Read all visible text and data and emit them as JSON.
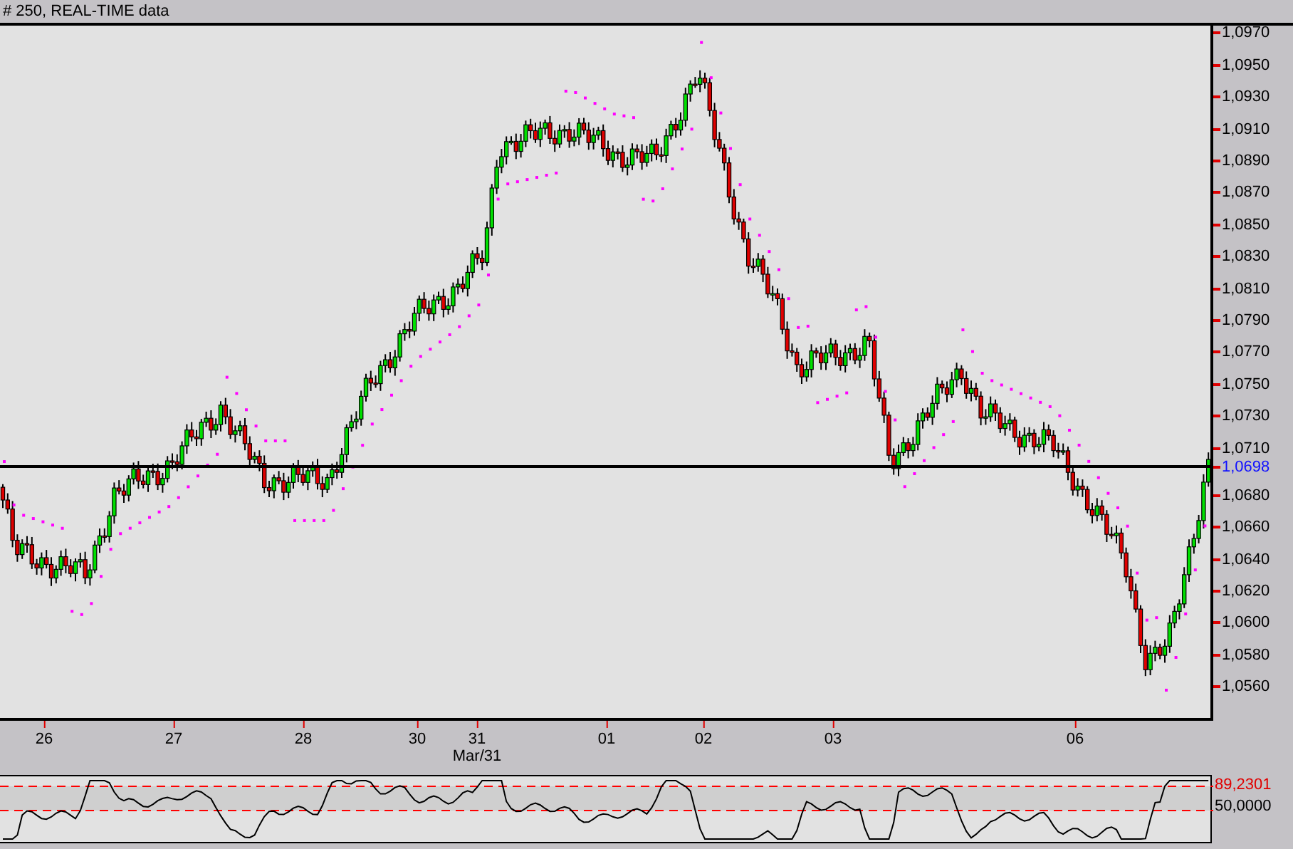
{
  "window": {
    "title": "# 250, REAL-TIME data"
  },
  "price_axis": {
    "ticks": [
      "1,0970",
      "1,0950",
      "1,0930",
      "1,0910",
      "1,0890",
      "1,0870",
      "1,0850",
      "1,0830",
      "1,0810",
      "1,0790",
      "1,0770",
      "1,0750",
      "1,0730",
      "1,0710",
      "1,0680",
      "1,0660",
      "1,0640",
      "1,0620",
      "1,0600",
      "1,0580",
      "1,0560"
    ],
    "current_price": "1,0698"
  },
  "time_axis": {
    "ticks": [
      {
        "label": "26"
      },
      {
        "label": "27"
      },
      {
        "label": "28"
      },
      {
        "label": "30"
      },
      {
        "label": "31",
        "sublabel": "Mar/31"
      },
      {
        "label": "01"
      },
      {
        "label": "02"
      },
      {
        "label": "03"
      },
      {
        "label": "06"
      }
    ]
  },
  "indicator": {
    "upper_value": "89,2301",
    "middle_value": "50,0000"
  }
}
